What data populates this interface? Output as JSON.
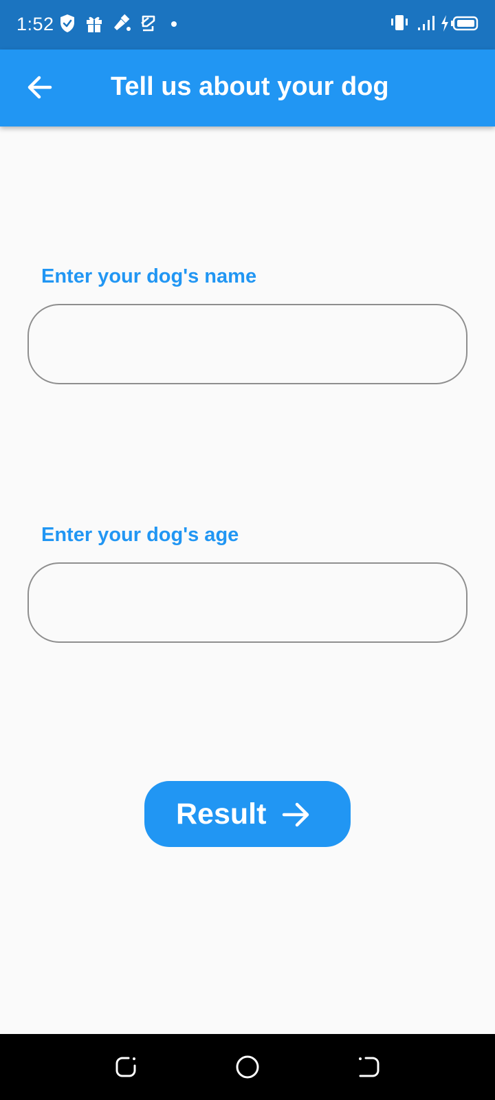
{
  "status_bar": {
    "time": "1:52",
    "icons": [
      "shield-icon",
      "gift-icon",
      "paint-icon",
      "sync-icon",
      "notification-dot-icon",
      "vibrate-icon",
      "signal-icon",
      "charging-icon",
      "battery-icon"
    ]
  },
  "app_bar": {
    "title": "Tell us about your dog",
    "back_icon": "arrow-left-icon"
  },
  "form": {
    "name_label": "Enter your dog's name",
    "name_value": "",
    "age_label": "Enter your dog's age",
    "age_value": ""
  },
  "result_button": {
    "label": "Result",
    "icon": "arrow-right-icon"
  },
  "nav_bar": {
    "icons": [
      "recent-apps-icon",
      "home-icon",
      "back-icon"
    ]
  },
  "colors": {
    "status_bar": "#1b74c0",
    "primary": "#2196f3",
    "background": "#fafafa",
    "field_border": "#8e8e8e",
    "nav_bar": "#000000"
  }
}
